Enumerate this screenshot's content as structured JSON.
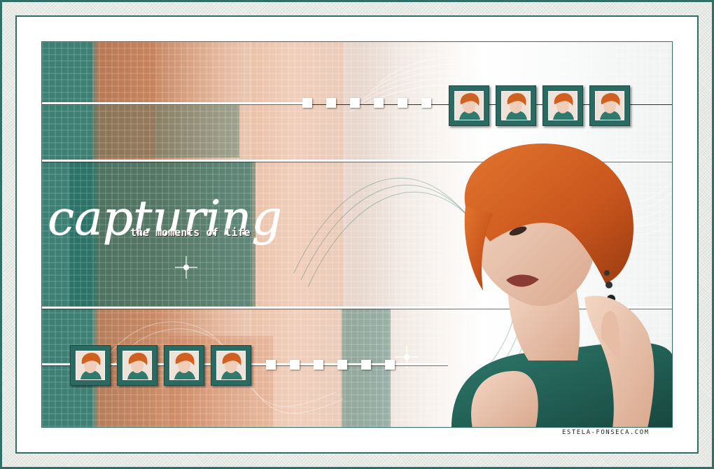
{
  "artwork": {
    "title_script": "capturing",
    "subtitle": "the moments of life",
    "watermark": "ESTELA-FONSECA.COM"
  },
  "colors": {
    "teal": "#2b6a61",
    "rust": "#c9612c",
    "cream": "#f4ddd0",
    "frame": "#2f6f66"
  },
  "thumbnails_top_count": 4,
  "thumbnails_bottom_count": 4,
  "squares_top_count": 6,
  "squares_bottom_count": 6
}
